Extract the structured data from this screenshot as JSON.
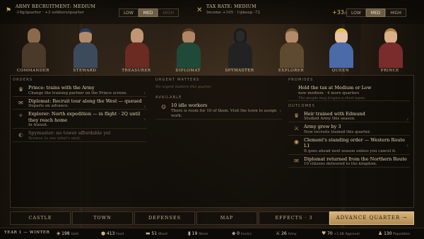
{
  "topbar": {
    "army": {
      "title": "ARMY RECRUITMENT: MEDIUM",
      "sub": "-16g/quarter · +3 soldiers/quarter",
      "options": [
        "LOW",
        "MED",
        "HIGH"
      ]
    },
    "tax": {
      "title": "TAX RATE: MEDIUM",
      "sub": "Income +105 · Upkeep -72",
      "options": [
        "LOW",
        "MED",
        "HIGH"
      ]
    },
    "tax_delta": "+33",
    "tax_delta_unit": "/Q"
  },
  "council": [
    {
      "role": "COMMANDER"
    },
    {
      "role": "STEWARD"
    },
    {
      "role": "TREASURER"
    },
    {
      "role": "DIPLOMAT"
    },
    {
      "role": "SPYMASTER"
    },
    {
      "role": "EXPLORER"
    },
    {
      "role": "QUEEN"
    },
    {
      "role": "PRINCE"
    }
  ],
  "orders": {
    "header": "ORDERS",
    "items": [
      {
        "title": "Prince: trains with the Army",
        "desc": "Change the training partner on the Prince screen."
      },
      {
        "title": "Diplomat: Recruit tour along the West — queued",
        "desc": "Departs on advance."
      },
      {
        "title": "Explorer: North expedition — in flight · 2Q until they reach home",
        "desc": "In transit."
      },
      {
        "title": "Spymaster: no tower affordable yet",
        "desc": "Browse to see what's next."
      }
    ]
  },
  "urgent": {
    "header": "URGENT MATTERS",
    "empty": "No urgent matters this quarter"
  },
  "available": {
    "header": "AVAILABLE",
    "item": {
      "title": "10 idle workers",
      "desc": "There is room for 10 of them. Visit the town to assign work."
    }
  },
  "promises": {
    "header": "PROMISES",
    "item": {
      "title": "Hold the tax at Medium or Low",
      "desc": "now medium · 4 more quarters",
      "hint": "The people may forgive a short lapse."
    }
  },
  "outcomes": {
    "header": "OUTCOMES",
    "items": [
      {
        "title": "Heir trained with Edmund",
        "desc": "Studied Army this season."
      },
      {
        "title": "Army grew by 3",
        "desc": "New recruits trained this quarter."
      },
      {
        "title": "Clement's standing order — Western Route L1",
        "desc": "It goes ahead next season unless you cancel it."
      },
      {
        "title": "Diplomat returned from the Northern Route",
        "desc": "10 citizens delivered to the kingdom."
      }
    ]
  },
  "tabs": {
    "castle": "CASTLE",
    "town": "TOWN",
    "defenses": "DEFENSES",
    "map": "MAP",
    "effects": "EFFECTS · 3",
    "advance": "ADVANCE QUARTER →"
  },
  "status": {
    "season": "YEAR 1 — WINTER",
    "resources": [
      {
        "icon": "gold",
        "value": "198",
        "label": "Gold"
      },
      {
        "icon": "food",
        "value": "413",
        "label": "Food"
      },
      {
        "icon": "wood",
        "value": "51",
        "label": "Wood"
      },
      {
        "icon": "stone",
        "value": "19",
        "label": "Stone"
      },
      {
        "icon": "iron",
        "value": "0",
        "label": "Ironics"
      },
      {
        "icon": "army",
        "value": "26",
        "label": "Army"
      },
      {
        "icon": "approval",
        "value": "70",
        "label": "Approval",
        "extra": "+1.08"
      },
      {
        "icon": "population",
        "value": "130",
        "label": "Population"
      }
    ]
  },
  "colors": {
    "accent": "#d8b57c",
    "panel": "#0e0b08",
    "text": "#d8c9a8"
  }
}
